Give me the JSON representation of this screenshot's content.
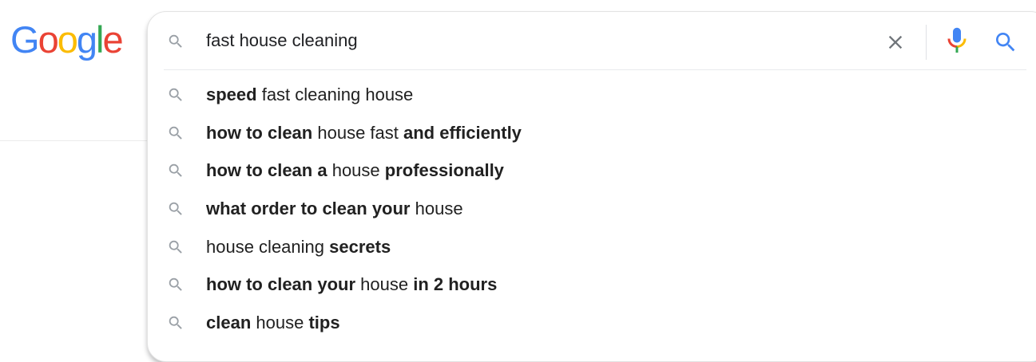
{
  "logo": {
    "letters": [
      "G",
      "o",
      "o",
      "g",
      "l",
      "e"
    ],
    "colors": [
      "#4285F4",
      "#EA4335",
      "#FBBC05",
      "#4285F4",
      "#34A853",
      "#EA4335"
    ]
  },
  "search": {
    "query": "fast house cleaning",
    "icons": {
      "leading": "search-icon",
      "clear": "close-icon",
      "voice": "microphone-icon",
      "submit": "search-icon"
    }
  },
  "suggestions": [
    {
      "segments": [
        {
          "t": "speed",
          "b": true
        },
        {
          "t": " fast cleaning house",
          "b": false
        }
      ]
    },
    {
      "segments": [
        {
          "t": "how to clean",
          "b": true
        },
        {
          "t": " house fast ",
          "b": false
        },
        {
          "t": "and efficiently",
          "b": true
        }
      ]
    },
    {
      "segments": [
        {
          "t": "how to clean a",
          "b": true
        },
        {
          "t": " house ",
          "b": false
        },
        {
          "t": "professionally",
          "b": true
        }
      ]
    },
    {
      "segments": [
        {
          "t": "what order to clean your",
          "b": true
        },
        {
          "t": " house",
          "b": false
        }
      ]
    },
    {
      "segments": [
        {
          "t": "house cleaning ",
          "b": false
        },
        {
          "t": "secrets",
          "b": true
        }
      ]
    },
    {
      "segments": [
        {
          "t": "how to clean your",
          "b": true
        },
        {
          "t": " house ",
          "b": false
        },
        {
          "t": "in 2 hours",
          "b": true
        }
      ]
    },
    {
      "segments": [
        {
          "t": "clean",
          "b": true
        },
        {
          "t": " house ",
          "b": false
        },
        {
          "t": "tips",
          "b": true
        }
      ]
    }
  ]
}
